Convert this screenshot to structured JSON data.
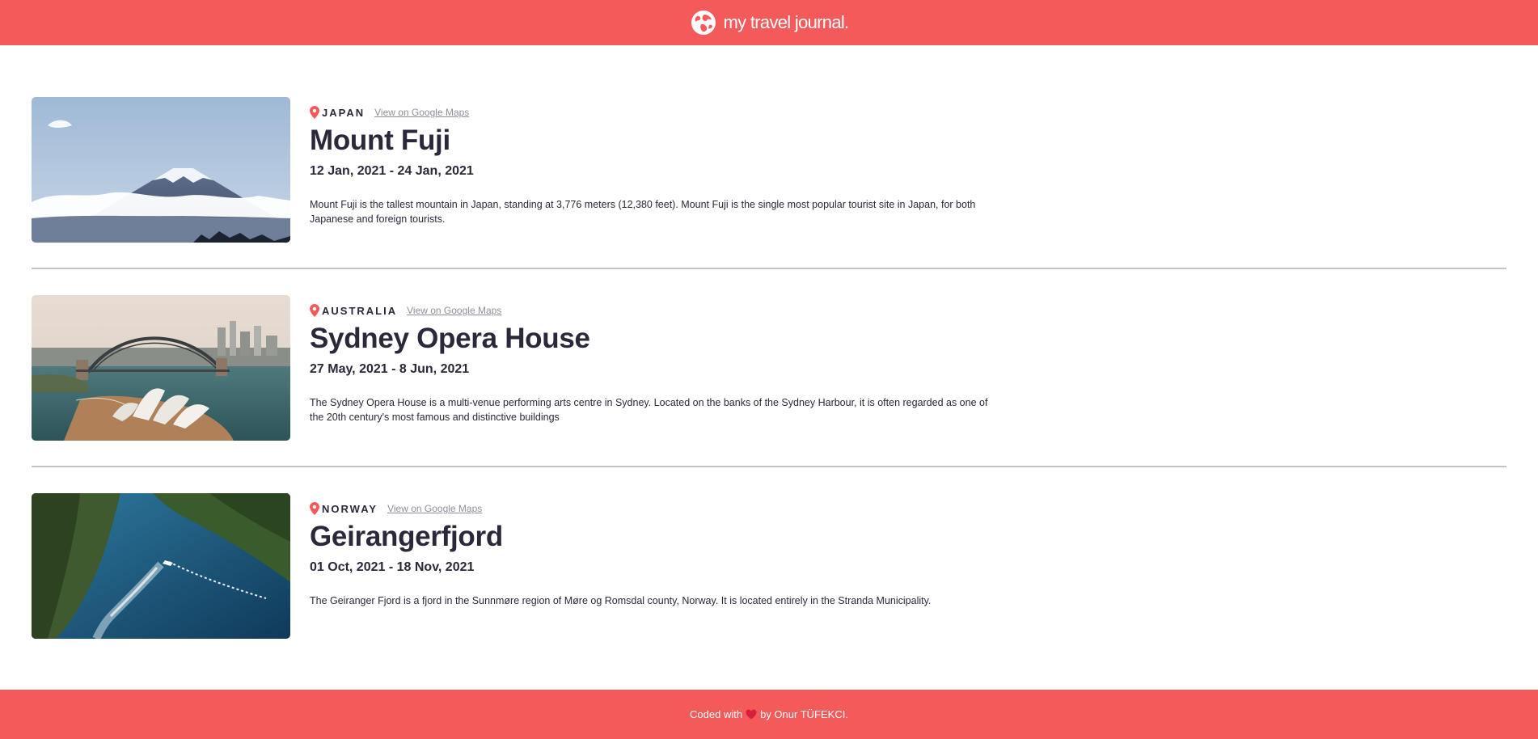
{
  "header": {
    "brand": "my travel journal.",
    "logo_icon": "globe-icon",
    "background": "#F55A5A"
  },
  "entries": [
    {
      "country": "JAPAN",
      "maps_link": "View on Google Maps",
      "title": "Mount Fuji",
      "dates": "12 Jan, 2021 - 24 Jan, 2021",
      "description": "Mount Fuji is the tallest mountain in Japan, standing at 3,776 meters (12,380 feet). Mount Fuji is the single most popular tourist site in Japan, for both Japanese and foreign tourists.",
      "image": "mount-fuji-photo"
    },
    {
      "country": "AUSTRALIA",
      "maps_link": "View on Google Maps",
      "title": "Sydney Opera House",
      "dates": "27 May, 2021 - 8 Jun, 2021",
      "description": "The Sydney Opera House is a multi-venue performing arts centre in Sydney. Located on the banks of the Sydney Harbour, it is often regarded as one of the 20th century's most famous and distinctive buildings",
      "image": "sydney-opera-house-photo"
    },
    {
      "country": "NORWAY",
      "maps_link": "View on Google Maps",
      "title": "Geirangerfjord",
      "dates": "01 Oct, 2021 - 18 Nov, 2021",
      "description": "The Geiranger Fjord is a fjord in the Sunnmøre region of Møre og Romsdal county, Norway. It is located entirely in the Stranda Municipality.",
      "image": "geirangerfjord-photo"
    }
  ],
  "footer": {
    "prefix": "Coded with",
    "icon": "heart-icon",
    "suffix": "by Onur TÜFEKCI."
  },
  "colors": {
    "accent": "#F55A5A",
    "text": "#2B283A",
    "muted": "#918E9B"
  }
}
